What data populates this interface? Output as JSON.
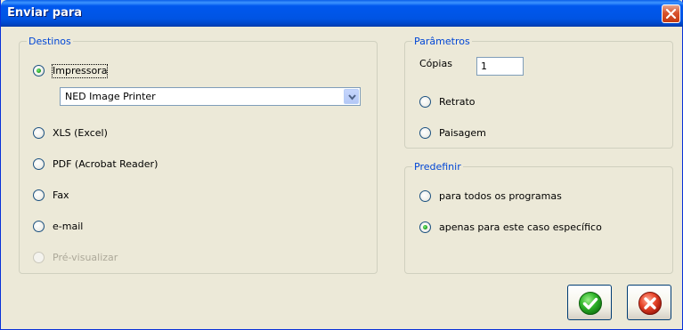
{
  "window": {
    "title": "Enviar para"
  },
  "destinos": {
    "legend": "Destinos",
    "options": [
      {
        "label": "Impressora",
        "checked": true
      },
      {
        "label": "XLS (Excel)",
        "checked": false
      },
      {
        "label": "PDF (Acrobat Reader)",
        "checked": false
      },
      {
        "label": "Fax",
        "checked": false
      },
      {
        "label": "e-mail",
        "checked": false
      },
      {
        "label": "Pré-visualizar",
        "checked": false,
        "disabled": true
      }
    ],
    "printer_select": {
      "value": "NED Image Printer"
    }
  },
  "parametros": {
    "legend": "Parâmetros",
    "copies_label": "Cópias",
    "copies_value": "1",
    "orientation": [
      {
        "label": "Retrato",
        "checked": false
      },
      {
        "label": "Paisagem",
        "checked": false
      }
    ]
  },
  "predefinir": {
    "legend": "Predefinir",
    "options": [
      {
        "label": "para todos os programas",
        "checked": false
      },
      {
        "label": "apenas para este caso específico",
        "checked": true
      }
    ]
  },
  "buttons": {
    "ok_icon": "green-check-icon",
    "cancel_icon": "red-x-icon"
  },
  "colors": {
    "title_bar": "#0054e3",
    "legend_text": "#0046d5",
    "dialog_bg": "#ece9d8"
  }
}
